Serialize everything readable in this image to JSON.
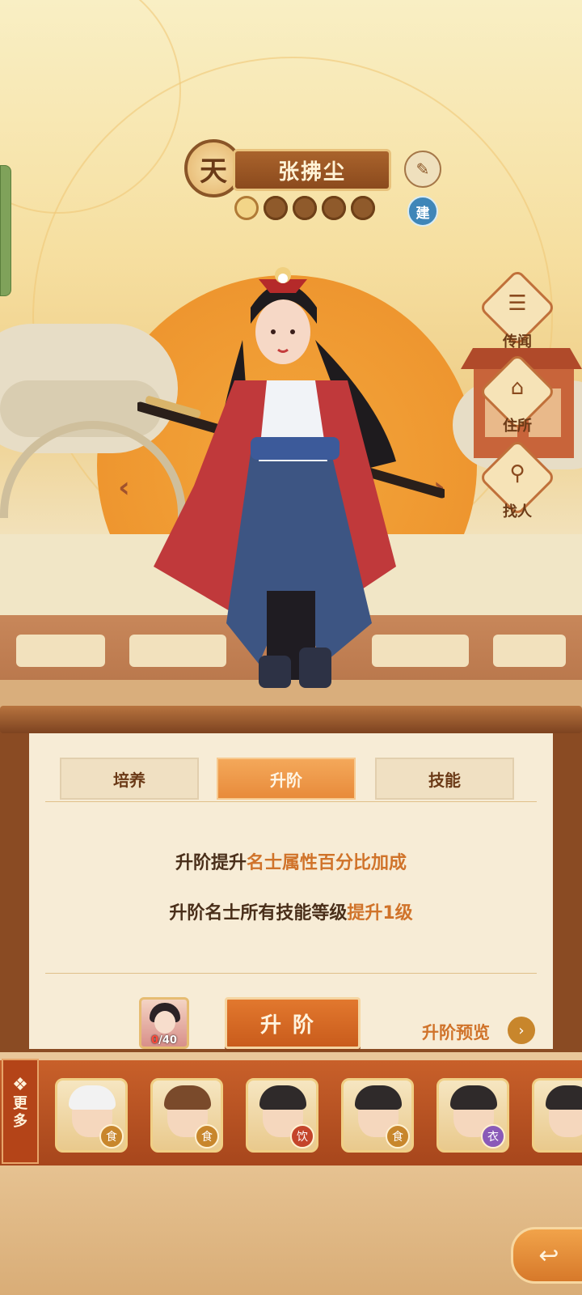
{
  "character": {
    "rank_char": "天",
    "name": "张拂尘",
    "element_char": "建",
    "stars_lit": 1,
    "stars_total": 5
  },
  "side_buttons": [
    {
      "label": "传闻",
      "icon": "scroll-icon"
    },
    {
      "label": "住所",
      "icon": "house-icon"
    },
    {
      "label": "找人",
      "icon": "search-person-icon"
    }
  ],
  "tabs": [
    {
      "label": "培养",
      "active": false
    },
    {
      "label": "升阶",
      "active": true
    },
    {
      "label": "技能",
      "active": false
    }
  ],
  "upgrade_info": {
    "line1_prefix": "升阶提升",
    "line1_highlight": "名士属性百分比加成",
    "line2_prefix": "升阶名士所有技能等级",
    "line2_highlight": "提升1级"
  },
  "material": {
    "have": "0",
    "need": "/40"
  },
  "upgrade_button": "升阶",
  "preview_label": "升阶预览",
  "more_button": {
    "line1": "更",
    "line2": "多"
  },
  "roster": [
    {
      "tag": "食",
      "tag_color": "#c8862c"
    },
    {
      "tag": "食",
      "tag_color": "#c8862c"
    },
    {
      "tag": "饮",
      "tag_color": "#c4452b"
    },
    {
      "tag": "食",
      "tag_color": "#c8862c"
    },
    {
      "tag": "衣",
      "tag_color": "#8a5ab8"
    }
  ],
  "colors": {
    "accent_orange": "#e88b3b",
    "highlight_text": "#d0732a",
    "frame_brown": "#8a4b23"
  }
}
